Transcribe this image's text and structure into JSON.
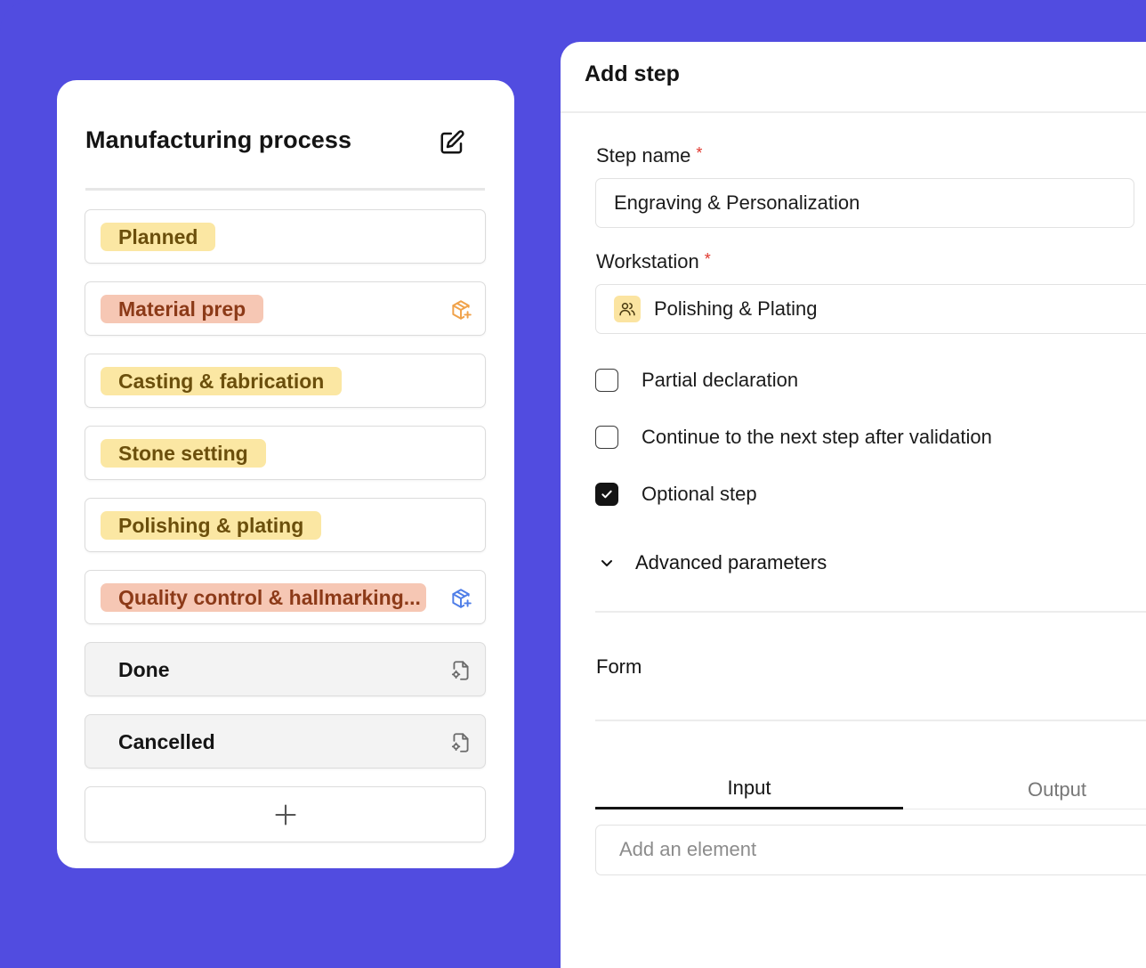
{
  "colors": {
    "background": "#514ce0",
    "tag_yellow_bg": "#fbe7a3",
    "tag_yellow_text": "#6b4f0c",
    "tag_orange_bg": "#f6c7b4",
    "tag_orange_text": "#8c3a18",
    "required_star": "#e0362c",
    "accent_icon_blue": "#4f7ee8",
    "accent_icon_orange": "#f0a24a"
  },
  "process": {
    "title": "Manufacturing process",
    "edit_icon": "edit-square-icon",
    "steps": [
      {
        "label": "Planned",
        "style": "yellow",
        "icon": null
      },
      {
        "label": "Material prep",
        "style": "orange",
        "icon": "package-plus-icon"
      },
      {
        "label": "Casting & fabrication",
        "style": "yellow",
        "icon": null
      },
      {
        "label": "Stone setting",
        "style": "yellow",
        "icon": null
      },
      {
        "label": "Polishing & plating",
        "style": "yellow",
        "icon": null
      },
      {
        "label": "Quality control & hallmarking...",
        "style": "orange",
        "icon": "package-plus-icon"
      },
      {
        "label": "Done",
        "style": "plain",
        "icon": "document-settings-icon"
      },
      {
        "label": "Cancelled",
        "style": "plain",
        "icon": "document-settings-icon"
      }
    ],
    "add_icon": "plus-icon"
  },
  "add_step": {
    "title": "Add step",
    "step_name_label": "Step name",
    "required_mark": "*",
    "step_name_value": "Engraving & Personalization",
    "workstation_label": "Workstation",
    "workstation_value": "Polishing & Plating",
    "workstation_icon": "users-icon",
    "checkboxes": [
      {
        "label": "Partial declaration",
        "checked": false
      },
      {
        "label": "Continue to the next step after validation",
        "checked": false
      },
      {
        "label": "Optional step",
        "checked": true
      }
    ],
    "advanced_label": "Advanced parameters",
    "form_label": "Form",
    "tabs": [
      "Input",
      "Output"
    ],
    "active_tab": "Input",
    "add_element_placeholder": "Add an element"
  }
}
